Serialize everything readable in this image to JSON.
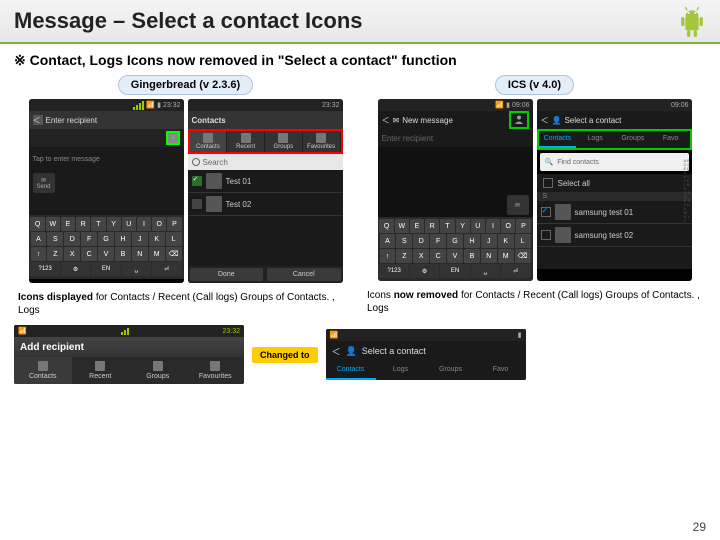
{
  "header": {
    "title": "Message – Select a contact Icons"
  },
  "subtitle": "※ Contact, Logs Icons now removed in \"Select a contact\" function",
  "labels": {
    "gingerbread": "Gingerbread\n(v 2.3.6)",
    "ics": "ICS (v 4.0)"
  },
  "gb": {
    "status_time": "23:32",
    "enter_recipient": "Enter recipient",
    "tap_msg": "Tap to enter message",
    "send": "Send",
    "contacts_header": "Contacts",
    "tabs": [
      "Contacts",
      "Recent",
      "Groups",
      "Favourites"
    ],
    "search": "Search",
    "items": [
      "Test 01",
      "Test 02"
    ],
    "done": "Done",
    "cancel": "Cancel"
  },
  "ics": {
    "status_time": "09:06",
    "new_message": "New message",
    "enter_recipient": "Enter recipient",
    "select_contact": "Select a contact",
    "tabs": [
      "Contacts",
      "Logs",
      "Groups",
      "Favo"
    ],
    "find": "Find contacts",
    "select_all": "Select all",
    "letter": "S",
    "items": [
      "samsung test 01",
      "samsung test 02"
    ]
  },
  "keys": {
    "r1": [
      "Q",
      "W",
      "E",
      "R",
      "T",
      "Y",
      "U",
      "I",
      "O",
      "P"
    ],
    "r2": [
      "A",
      "S",
      "D",
      "F",
      "G",
      "H",
      "J",
      "K",
      "L"
    ],
    "r3": [
      "↑",
      "Z",
      "X",
      "C",
      "V",
      "B",
      "N",
      "M",
      "⌫"
    ],
    "r4": [
      "?123",
      "⚙",
      "EN",
      "␣",
      "⏎"
    ]
  },
  "captions": {
    "left": "Icons displayed for Contacts / Recent (Call logs) Groups  of Contacts. , Logs",
    "left_bold": "Icons displayed",
    "right": "Icons now removed for Contacts / Recent (Call logs) Groups  of Contacts. , Logs",
    "right_bold": "now removed"
  },
  "strip": {
    "old_time": "23:32",
    "old_title": "Add recipient",
    "old_tabs": [
      "Contacts",
      "Recent",
      "Groups",
      "Favourites"
    ],
    "changed": "Changed to",
    "new_title": "Select a contact",
    "new_tabs": [
      "Contacts",
      "Logs",
      "Groups",
      "Favo"
    ]
  },
  "page": "29"
}
